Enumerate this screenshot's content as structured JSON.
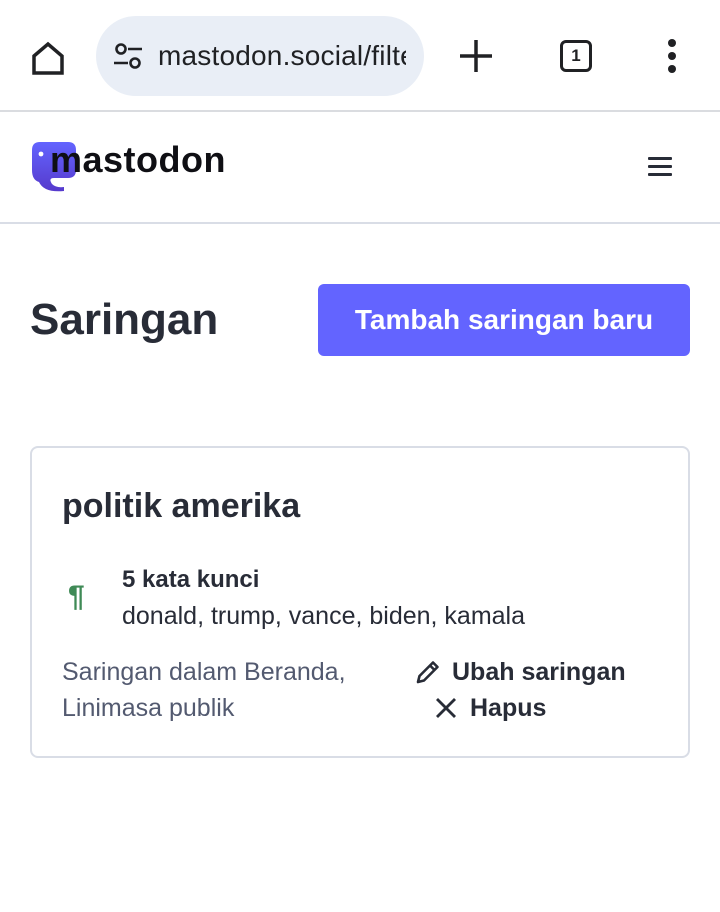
{
  "browser": {
    "url": "mastodon.social/filters",
    "tab_count": "1",
    "icons": {
      "home": "home-icon",
      "site_settings": "tune-icon",
      "new_tab": "plus-icon",
      "tabs": "tab-switcher-icon",
      "menu": "more-vert-icon"
    }
  },
  "site": {
    "logo_text": "mastodon",
    "brand_color": "#6364ff",
    "menu_icon": "hamburger-icon"
  },
  "page": {
    "title": "Saringan",
    "add_button_label": "Tambah saringan baru"
  },
  "filters": [
    {
      "title": "politik amerika",
      "keyword_count_label": "5 kata kunci",
      "keywords": "donald, trump, vance, biden, kamala",
      "context": "Saringan dalam Beranda, Linimasa publik",
      "edit_label": "Ubah saringan",
      "delete_label": "Hapus",
      "keyword_icon": "pilcrow-icon",
      "edit_icon": "pencil-icon",
      "delete_icon": "close-icon"
    }
  ]
}
